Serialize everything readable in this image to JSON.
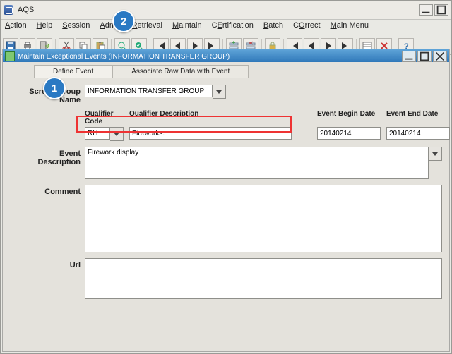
{
  "window": {
    "title": "AQS"
  },
  "menus": {
    "action": {
      "label": "Action",
      "mn": "A"
    },
    "help": {
      "label": "Help",
      "mn": "H"
    },
    "session": {
      "label": "Session",
      "mn": "S"
    },
    "admin": {
      "label": "Admin",
      "mn": "A"
    },
    "retrieval": {
      "label": "Retrieval",
      "mn": "R"
    },
    "maintain": {
      "label": "Maintain",
      "mn": "M"
    },
    "cert": {
      "label": "CErtification",
      "mn": "E"
    },
    "batch": {
      "label": "Batch",
      "mn": "B"
    },
    "correct": {
      "label": "COrrect",
      "mn": "O"
    },
    "main": {
      "label": "Main Menu",
      "mn": "M"
    }
  },
  "subwindow": {
    "title": "Maintain Exceptional Events (INFORMATION TRANSFER GROUP)"
  },
  "tabs": {
    "define": "Define Event",
    "associate": "Associate Raw Data with Event"
  },
  "fields": {
    "screen_group": {
      "label": "Screen Group Name",
      "value": "INFORMATION TRANSFER GROUP"
    },
    "qualifier_code": {
      "label": "Qualifier Code",
      "value": "RH"
    },
    "qualifier_desc": {
      "label": "Qualifier Description",
      "value": "Fireworks."
    },
    "event_begin": {
      "label": "Event Begin Date",
      "value": "20140214"
    },
    "event_end": {
      "label": "Event End Date",
      "value": "20140214"
    },
    "event_desc": {
      "label": "Event Description",
      "value": "Firework display"
    },
    "comment": {
      "label": "Comment",
      "value": ""
    },
    "url": {
      "label": "Url",
      "value": ""
    }
  },
  "callouts": {
    "a": "1",
    "b": "2"
  }
}
